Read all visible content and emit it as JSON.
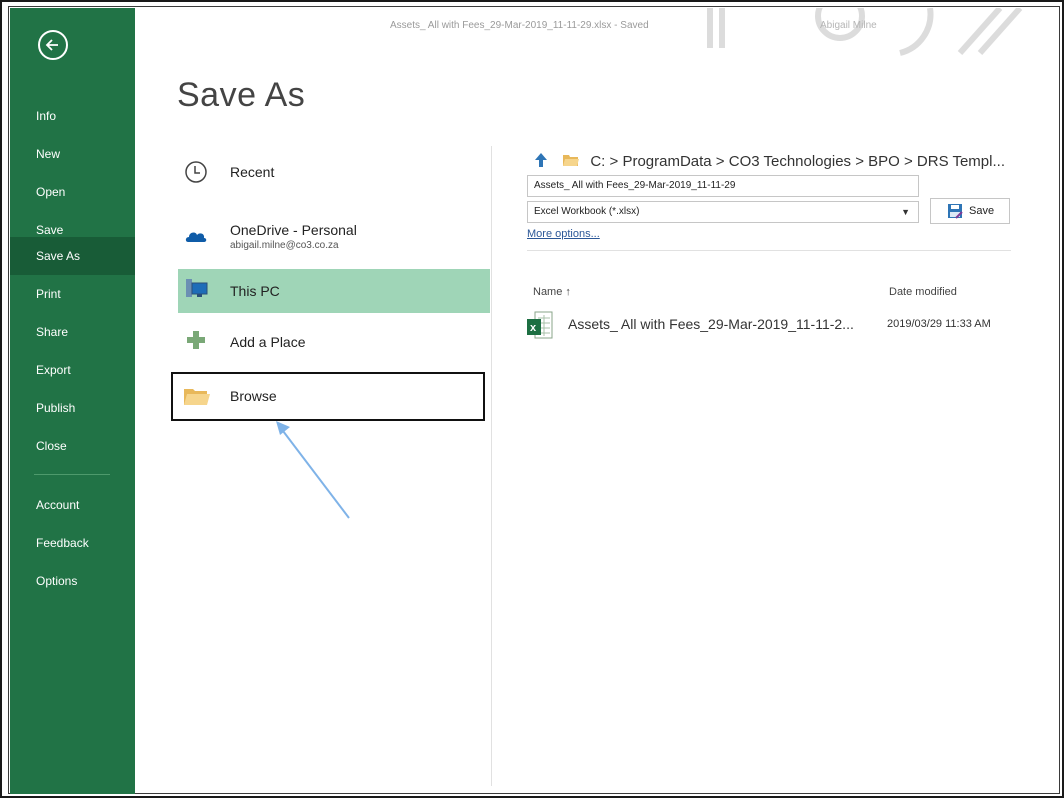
{
  "titlebar": {
    "document": "Assets_ All with Fees_29-Mar-2019_11-11-29.xlsx - Saved",
    "user": "Abigail Milne"
  },
  "sidebar": {
    "items": [
      {
        "label": "Info"
      },
      {
        "label": "New"
      },
      {
        "label": "Open"
      },
      {
        "label": "Save"
      },
      {
        "label": "Save As"
      },
      {
        "label": "Print"
      },
      {
        "label": "Share"
      },
      {
        "label": "Export"
      },
      {
        "label": "Publish"
      },
      {
        "label": "Close"
      },
      {
        "label": "Account"
      },
      {
        "label": "Feedback"
      },
      {
        "label": "Options"
      }
    ],
    "active": "Save As"
  },
  "page": {
    "title": "Save As"
  },
  "locations": {
    "recent": "Recent",
    "onedrive": "OneDrive - Personal",
    "onedrive_account": "abigail.milne@co3.co.za",
    "this_pc": "This PC",
    "add_place": "Add a Place",
    "browse": "Browse"
  },
  "save_panel": {
    "path": "C: > ProgramData > CO3 Technologies > BPO > DRS Templ...",
    "filename": "Assets_ All with Fees_29-Mar-2019_11-11-29",
    "filetype": "Excel Workbook (*.xlsx)",
    "save_label": "Save",
    "more_options": "More options..."
  },
  "file_list": {
    "col_name": "Name ↑",
    "col_date": "Date modified",
    "rows": [
      {
        "name": "Assets_ All with Fees_29-Mar-2019_11-11-2...",
        "date": "2019/03/29 11:33 AM"
      }
    ]
  },
  "colors": {
    "accent": "#217346",
    "accent_dark": "#185c37",
    "selected_location": "#9fd5b7",
    "link": "#2b5797"
  }
}
